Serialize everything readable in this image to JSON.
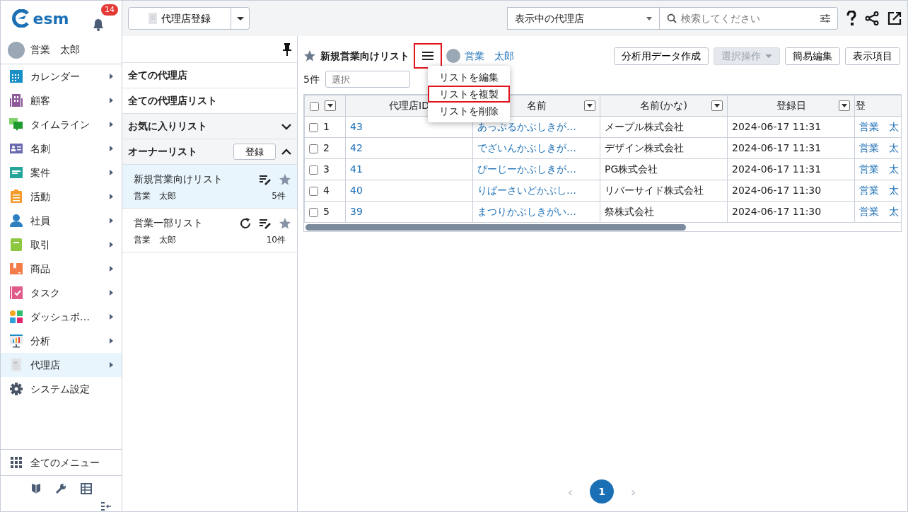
{
  "sidebar": {
    "logo": "esm",
    "notification_count": "14",
    "user": "営業　太郎",
    "items": [
      {
        "label": "カレンダー",
        "submenu": true,
        "selected": false
      },
      {
        "label": "顧客",
        "submenu": true,
        "selected": false
      },
      {
        "label": "タイムライン",
        "submenu": true,
        "selected": false
      },
      {
        "label": "名刺",
        "submenu": true,
        "selected": false
      },
      {
        "label": "案件",
        "submenu": true,
        "selected": false
      },
      {
        "label": "活動",
        "submenu": true,
        "selected": false
      },
      {
        "label": "社員",
        "submenu": true,
        "selected": false
      },
      {
        "label": "取引",
        "submenu": true,
        "selected": false
      },
      {
        "label": "商品",
        "submenu": true,
        "selected": false
      },
      {
        "label": "タスク",
        "submenu": true,
        "selected": false
      },
      {
        "label": "ダッシュボ…",
        "submenu": true,
        "selected": false
      },
      {
        "label": "分析",
        "submenu": true,
        "selected": false
      },
      {
        "label": "代理店",
        "submenu": true,
        "selected": true
      },
      {
        "label": "システム設定",
        "submenu": false,
        "selected": false
      }
    ],
    "all_menu": "全てのメニュー"
  },
  "toolbar": {
    "register_button": "代理店登録",
    "scope_select": "表示中の代理店",
    "search": {
      "placeholder": "検索してください"
    }
  },
  "list_panel": {
    "sections": [
      {
        "label": "全ての代理店",
        "kind": "link"
      },
      {
        "label": "全ての代理店リスト",
        "kind": "link"
      },
      {
        "label": "お気に入りリスト",
        "kind": "group",
        "expanded": false
      },
      {
        "label": "オーナーリスト",
        "kind": "group",
        "expanded": true,
        "button": "登録"
      }
    ],
    "lists": [
      {
        "name": "新規営業向けリスト",
        "owner": "営業　太郎",
        "count": "5件",
        "selected": true,
        "refresh": false
      },
      {
        "name": "営業一部リスト",
        "owner": "営業　太郎",
        "count": "10件",
        "selected": false,
        "refresh": true
      }
    ]
  },
  "main": {
    "title": "新規営業向けリスト",
    "menu_button_highlighted": true,
    "owner": "営業　太郎",
    "buttons": [
      {
        "label": "分析用データ作成",
        "disabled": false,
        "caret": false
      },
      {
        "label": "選択操作",
        "disabled": true,
        "caret": true
      },
      {
        "label": "簡易編集",
        "disabled": false,
        "caret": false
      },
      {
        "label": "表示項目",
        "disabled": false,
        "caret": false
      }
    ],
    "count": "5件",
    "filter": {
      "placeholder": "選択"
    },
    "menu": [
      {
        "label": "リストを編集",
        "highlighted": false
      },
      {
        "label": "リストを複製",
        "highlighted": true
      },
      {
        "label": "リストを削除",
        "highlighted": false
      }
    ],
    "table": {
      "all_checked": false,
      "columns": [
        "代理店ID",
        "名前",
        "名前(かな)",
        "登録日",
        "登"
      ],
      "rows": [
        {
          "checked": false,
          "num": "1",
          "cells": [
            "43",
            "あっぷるかぶしきが…",
            "メープル株式会社",
            "2024-06-17 11:31",
            "営業　太"
          ]
        },
        {
          "checked": false,
          "num": "2",
          "cells": [
            "42",
            "でざいんかぶしきが…",
            "デザイン株式会社",
            "2024-06-17 11:31",
            "営業　太"
          ]
        },
        {
          "checked": false,
          "num": "3",
          "cells": [
            "41",
            "ぴーじーかぶしきが…",
            "PG株式会社",
            "2024-06-17 11:31",
            "営業　太"
          ]
        },
        {
          "checked": false,
          "num": "4",
          "cells": [
            "40",
            "りばーさいどかぶし…",
            "リバーサイド株式会社",
            "2024-06-17 11:30",
            "営業　太"
          ]
        },
        {
          "checked": false,
          "num": "5",
          "cells": [
            "39",
            "まつりかぶしきがい…",
            "祭株式会社",
            "2024-06-17 11:30",
            "営業　太"
          ]
        }
      ]
    },
    "pagination": [
      {
        "label": "1",
        "selected": true
      }
    ],
    "prev_page": "‹",
    "next_page": "›"
  }
}
